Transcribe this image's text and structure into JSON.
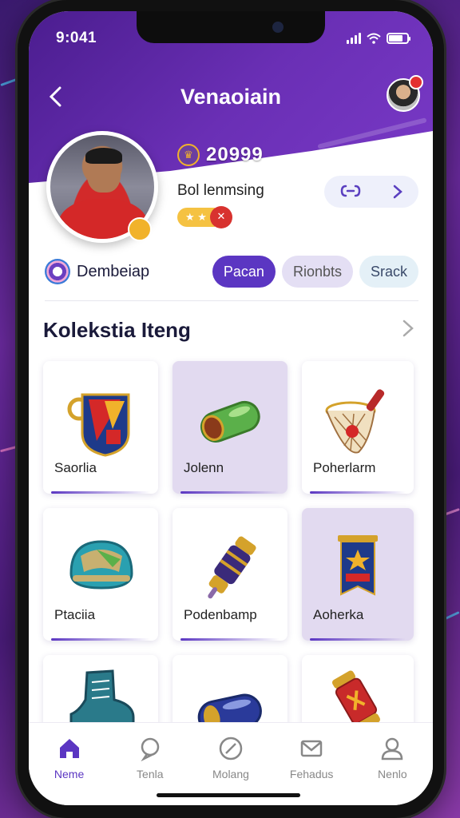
{
  "status_bar": {
    "time": "9:041"
  },
  "header": {
    "title": "Venaoiain",
    "back_icon": "chevron-left-icon",
    "notification_count": ""
  },
  "profile": {
    "score": "20999",
    "name": "Bol lenmsing",
    "stars": "★ ★",
    "badge": "",
    "action_icon": "link-icon"
  },
  "tabs": {
    "label": "Dembeiap",
    "items": [
      {
        "label": "Pacan",
        "active": true
      },
      {
        "label": "Rionbts",
        "active": false
      },
      {
        "label": "Srack",
        "active": false
      }
    ]
  },
  "collection": {
    "title": "Kolekstia Iteng",
    "items": [
      {
        "label": "Saorlia",
        "icon": "crest-icon",
        "style": "white"
      },
      {
        "label": "Jolenn",
        "icon": "green-gem-icon",
        "style": "lilac"
      },
      {
        "label": "Poherlarm",
        "icon": "net-basket-icon",
        "style": "white"
      },
      {
        "label": "Ptaciia",
        "icon": "helmet-icon",
        "style": "white"
      },
      {
        "label": "Podenbamp",
        "icon": "scroll-icon",
        "style": "white"
      },
      {
        "label": "Aoherka",
        "icon": "banner-icon",
        "style": "lilac"
      },
      {
        "label": "",
        "icon": "boot-icon",
        "style": "white"
      },
      {
        "label": "",
        "icon": "blue-capsule-icon",
        "style": "white"
      },
      {
        "label": "",
        "icon": "red-scroll-icon",
        "style": "white"
      }
    ]
  },
  "bottom_nav": [
    {
      "label": "Neme",
      "icon": "home-icon",
      "active": true
    },
    {
      "label": "Tenla",
      "icon": "chat-icon",
      "active": false
    },
    {
      "label": "Molang",
      "icon": "compass-icon",
      "active": false
    },
    {
      "label": "Fehadus",
      "icon": "mail-icon",
      "active": false
    },
    {
      "label": "Nenlo",
      "icon": "user-icon",
      "active": false
    }
  ],
  "colors": {
    "primary": "#5b36c2",
    "header": "#6a2fb5",
    "accent_gold": "#f1b22b"
  }
}
